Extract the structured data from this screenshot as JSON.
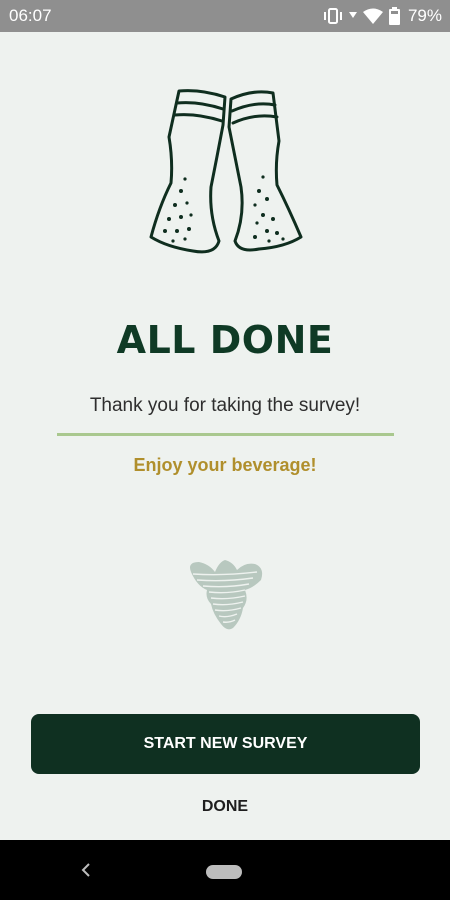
{
  "status_bar": {
    "time": "06:07",
    "battery_text": "79%",
    "icons": [
      "vibrate-icon",
      "wifi-icon",
      "signal-icon",
      "battery-icon"
    ]
  },
  "screen": {
    "title": "ALL DONE",
    "thanks_message": "Thank you for taking the survey!",
    "enjoy_message": "Enjoy your beverage!",
    "hero_icon": "beer-glasses-cheers-icon",
    "brand_logo": "brand-leaf-logo"
  },
  "actions": {
    "start_new_survey": "START NEW SURVEY",
    "done": "DONE"
  },
  "nav_bar": {
    "icons": [
      "back-icon",
      "home-pill-icon"
    ]
  },
  "colors": {
    "background": "#eef2ef",
    "title": "#0f3a25",
    "accent_gold": "#b08f2c",
    "divider": "#a9c88e",
    "primary_button": "#0f3021",
    "status_bar": "#8f8f8f"
  }
}
